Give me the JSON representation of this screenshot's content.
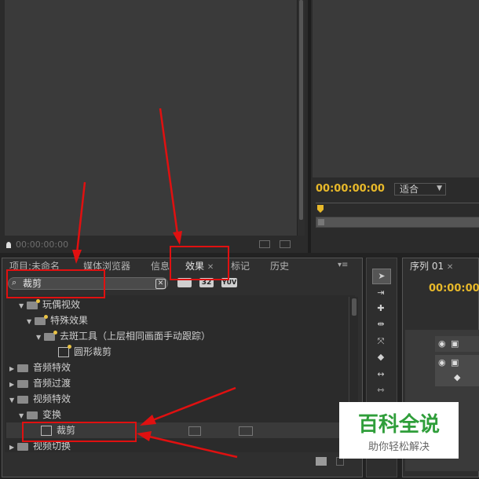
{
  "source_monitor": {
    "timecode": "00:00:00:00"
  },
  "program_monitor": {
    "timecode": "00:00:00:00",
    "fit_label": "适合"
  },
  "tabs": [
    {
      "label": "项目:未命名"
    },
    {
      "label": "媒体浏览器"
    },
    {
      "label": "信息"
    },
    {
      "label": "效果"
    },
    {
      "label": "标记"
    },
    {
      "label": "历史"
    }
  ],
  "effects_panel": {
    "search_value": "裁剪",
    "badges": [
      "32",
      "YUV"
    ],
    "tree": [
      {
        "label": "玩偶视效",
        "level": 1,
        "type": "folder",
        "expanded": true
      },
      {
        "label": "特殊效果",
        "level": 2,
        "type": "folder",
        "expanded": true
      },
      {
        "label": "去斑工具（上层相同画面手动跟踪）",
        "level": 3,
        "type": "folder",
        "expanded": true
      },
      {
        "label": "圆形裁剪",
        "level": 4,
        "type": "effect"
      },
      {
        "label": "音频特效",
        "level": 0,
        "type": "folder",
        "expanded": false
      },
      {
        "label": "音频过渡",
        "level": 0,
        "type": "folder",
        "expanded": false
      },
      {
        "label": "视频特效",
        "level": 0,
        "type": "folder",
        "expanded": true
      },
      {
        "label": "变换",
        "level": 1,
        "type": "folder",
        "expanded": true
      },
      {
        "label": "裁剪",
        "level": 2,
        "type": "effect",
        "selected": true
      },
      {
        "label": "视频切换",
        "level": 0,
        "type": "folder",
        "expanded": false
      }
    ]
  },
  "sequence_panel": {
    "tab_label": "序列 01",
    "timecode": "00:00:00:"
  },
  "watermark": {
    "title": "百科全说",
    "subtitle": "助你轻松解决"
  },
  "colors": {
    "timecode": "#e8b92a",
    "annotation": "#e01010",
    "watermark_green": "#2f9e3a"
  }
}
